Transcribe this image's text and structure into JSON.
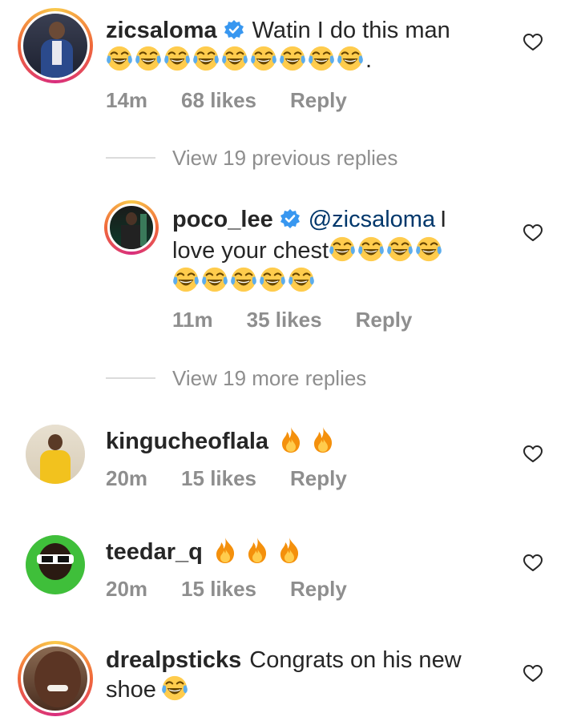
{
  "comments": [
    {
      "username": "zicsaloma",
      "text": "Watin I do this man",
      "text_suffix": ".",
      "time": "14m",
      "likes": "68 likes",
      "reply": "Reply"
    },
    {
      "view_previous": "View 19 previous replies"
    },
    {
      "username": "poco_lee",
      "mention": "@zicsaloma",
      "text_a": "I",
      "text_b": "love your chest",
      "time": "11m",
      "likes": "35 likes",
      "reply": "Reply"
    },
    {
      "view_more": "View 19 more replies"
    },
    {
      "username": "kingucheoflala",
      "time": "20m",
      "likes": "15 likes",
      "reply": "Reply"
    },
    {
      "username": "teedar_q",
      "time": "20m",
      "likes": "15 likes",
      "reply": "Reply"
    },
    {
      "username": "drealpsticks",
      "text_a": "Congrats on his new",
      "text_b": "shoe"
    }
  ],
  "icons": {
    "verified": "verified-badge-icon",
    "heart": "heart-outline-icon",
    "laugh": "tears-of-joy-emoji",
    "fire": "fire-emoji"
  },
  "colors": {
    "verified_blue": "#3897f0",
    "meta_grey": "#8e8e8e",
    "mention_blue": "#00376b"
  }
}
